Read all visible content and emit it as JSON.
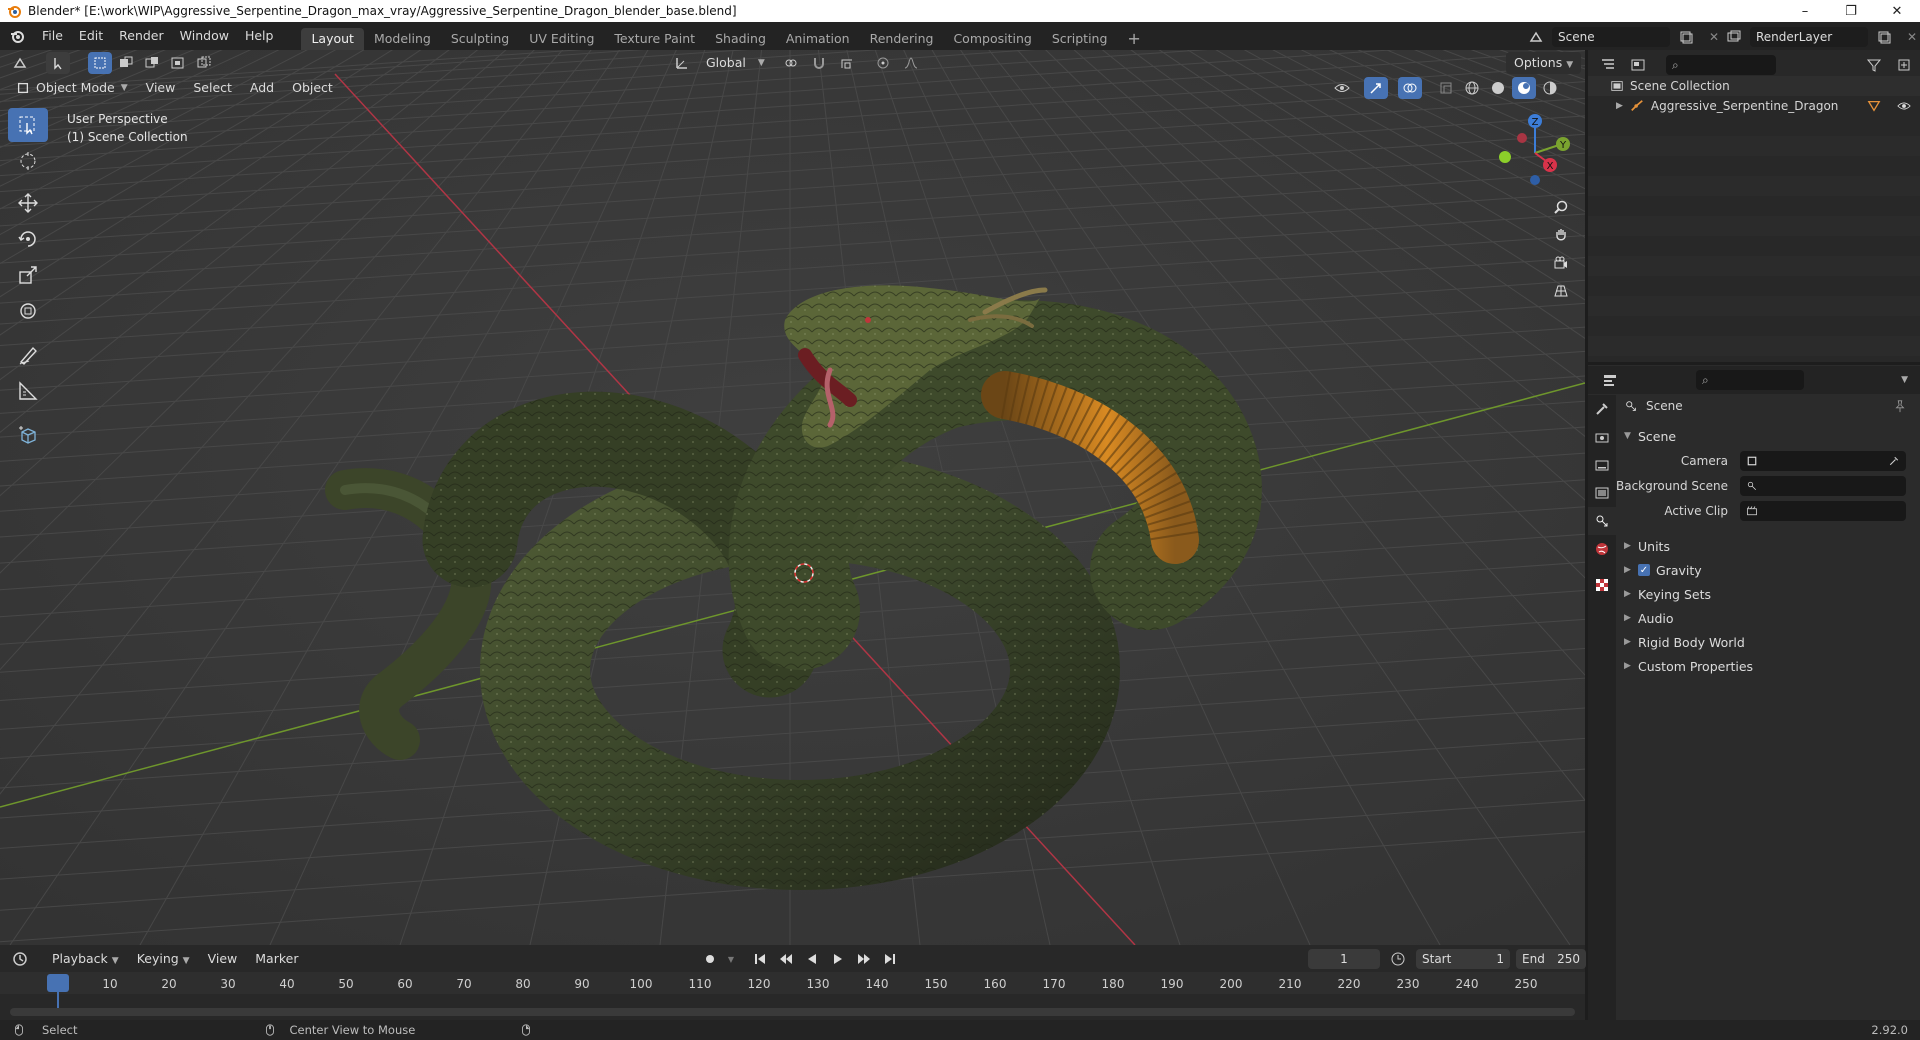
{
  "window": {
    "title": "Blender* [E:\\work\\WIP\\Aggressive_Serpentine_Dragon_max_vray/Aggressive_Serpentine_Dragon_blender_base.blend]",
    "controls": [
      "–",
      "❐",
      "✕"
    ]
  },
  "menu": [
    "File",
    "Edit",
    "Render",
    "Window",
    "Help"
  ],
  "workspaces": [
    "Layout",
    "Modeling",
    "Sculpting",
    "UV Editing",
    "Texture Paint",
    "Shading",
    "Animation",
    "Rendering",
    "Compositing",
    "Scripting"
  ],
  "active_workspace": "Layout",
  "scene_field": "Scene",
  "renderlayer_field": "RenderLayer",
  "viewport": {
    "mode": "Object Mode",
    "menus": [
      "View",
      "Select",
      "Add",
      "Object"
    ],
    "transform_orientation": "Global",
    "options_label": "Options",
    "overlay_text_1": "User Perspective",
    "overlay_text_2": "(1) Scene Collection",
    "gizmo": {
      "z": "Z",
      "y": "Y",
      "x": "X"
    }
  },
  "outliner": {
    "root": "Scene Collection",
    "items": [
      {
        "label": "Aggressive_Serpentine_Dragon"
      }
    ]
  },
  "properties": {
    "header": "Scene",
    "section": "Scene",
    "fields": [
      {
        "label": "Camera",
        "value": ""
      },
      {
        "label": "Background Scene",
        "value": ""
      },
      {
        "label": "Active Clip",
        "value": ""
      }
    ],
    "panels": [
      {
        "label": "Units",
        "checkbox": false
      },
      {
        "label": "Gravity",
        "checkbox": true,
        "checked": true
      },
      {
        "label": "Keying Sets",
        "checkbox": false
      },
      {
        "label": "Audio",
        "checkbox": false
      },
      {
        "label": "Rigid Body World",
        "checkbox": false
      },
      {
        "label": "Custom Properties",
        "checkbox": false
      }
    ]
  },
  "timeline": {
    "menus": [
      "Playback",
      "Keying",
      "View",
      "Marker"
    ],
    "current_frame": "1",
    "start_label": "Start",
    "start": "1",
    "end_label": "End",
    "end": "250",
    "ticks": [
      "1",
      "10",
      "20",
      "30",
      "40",
      "50",
      "60",
      "70",
      "80",
      "90",
      "100",
      "110",
      "120",
      "130",
      "140",
      "150",
      "160",
      "170",
      "180",
      "190",
      "200",
      "210",
      "220",
      "230",
      "240",
      "250"
    ]
  },
  "status": {
    "left": "Select",
    "middle": "Center View to Mouse",
    "version": "2.92.0"
  },
  "colors": {
    "accent": "#4772b3",
    "grid_line": "#444444",
    "x_axis": "#c0394a",
    "y_axis": "#7aa32f",
    "dragon_dark": "#2c331e",
    "dragon_belly": "#c57a1c"
  }
}
